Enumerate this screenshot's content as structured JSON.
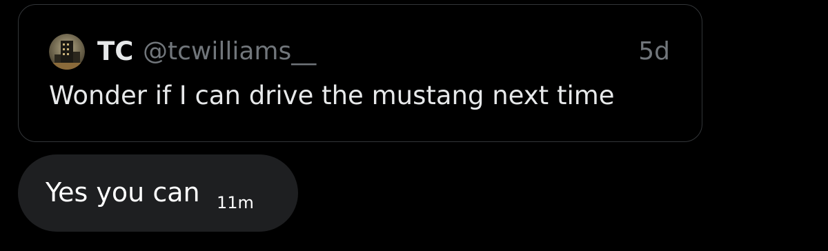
{
  "quoted_post": {
    "author_name": "TC",
    "author_handle": "@tcwilliams__",
    "timestamp": "5d",
    "text": "Wonder if I can drive the mustang next time"
  },
  "reply_message": {
    "text": "Yes you can",
    "timestamp": "11m"
  },
  "colors": {
    "background": "#000000",
    "card_border": "#333639",
    "primary_text": "#e7e9ea",
    "secondary_text": "#71767b",
    "bubble_background": "#1e1f21"
  },
  "icons": {
    "avatar": "profile-photo"
  }
}
